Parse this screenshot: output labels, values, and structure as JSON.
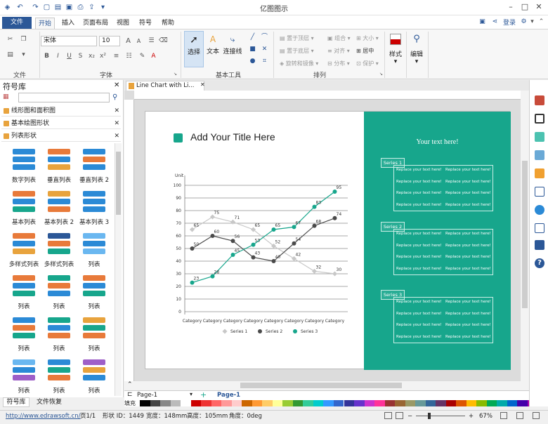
{
  "app": {
    "title": "亿图图示"
  },
  "menu": {
    "tabs": [
      "文件",
      "开始",
      "插入",
      "页面布局",
      "视图",
      "符号",
      "帮助"
    ],
    "login": "登录"
  },
  "ribbon": {
    "font_name": "宋体",
    "font_size": "10",
    "groups": {
      "file": "文件",
      "font": "字体",
      "basic_tools": "基本工具",
      "arrange": "排列"
    },
    "select": "选择",
    "text": "文本",
    "connector": "连接线",
    "arrange_items": [
      "置于顶层",
      "组合",
      "大小",
      "置于底层",
      "对齐",
      "居中",
      "旋转和镜像",
      "分布",
      "保护"
    ],
    "style": "样式",
    "edit": "编辑"
  },
  "library": {
    "title": "符号库",
    "search_placeholder": "",
    "categories": [
      "线形图和面积图",
      "基本绘图形状",
      "列表形状"
    ],
    "shapes": [
      "数字列表",
      "垂直列表",
      "垂直列表 2",
      "基本列表",
      "基本列表 2",
      "基本列表 3",
      "多样式列表",
      "多样式列表",
      "列表",
      "列表",
      "列表",
      "列表",
      "列表",
      "列表",
      "列表",
      "列表",
      "列表",
      "列表"
    ],
    "bottom_tabs": [
      "符号库",
      "文件恢复"
    ]
  },
  "document": {
    "tab": "Line Chart with Li...",
    "page_tab": "Page-1",
    "page_active": "Page-1",
    "fill_label": "填充"
  },
  "slide": {
    "title": "Add Your Title Here",
    "right_title": "Your text here!",
    "series_boxes": [
      "Series 1",
      "Series 2",
      "Series 3"
    ],
    "replace_text": "Replace your text here!"
  },
  "chart_data": {
    "type": "line",
    "ylabel": "Unit",
    "ylim": [
      0,
      100
    ],
    "yticks": [
      0,
      10,
      20,
      30,
      40,
      50,
      60,
      70,
      80,
      90,
      100
    ],
    "categories": [
      "Category",
      "Category",
      "Category",
      "Category",
      "Category",
      "Category",
      "Category",
      "Category"
    ],
    "series": [
      {
        "name": "Series 1",
        "color": "#c8c8c8",
        "values": [
          65,
          75,
          71,
          65,
          52,
          42,
          32,
          30
        ]
      },
      {
        "name": "Series 2",
        "color": "#4a4a4a",
        "values": [
          50,
          60,
          56,
          43,
          40,
          54,
          68,
          74
        ]
      },
      {
        "name": "Series 3",
        "color": "#17a68c",
        "values": [
          23,
          28,
          45,
          53,
          65,
          67,
          83,
          95
        ]
      }
    ]
  },
  "status": {
    "url": "http://www.edrawsoft.cn/",
    "page": "页1/1",
    "shape_id": "形状 ID：1449",
    "width": "宽度：148mm",
    "height": "高度：105mm",
    "angle": "角度：0deg",
    "zoom": "67%"
  },
  "colors": {
    "accent": "#2b5797",
    "teal": "#17a68c"
  }
}
